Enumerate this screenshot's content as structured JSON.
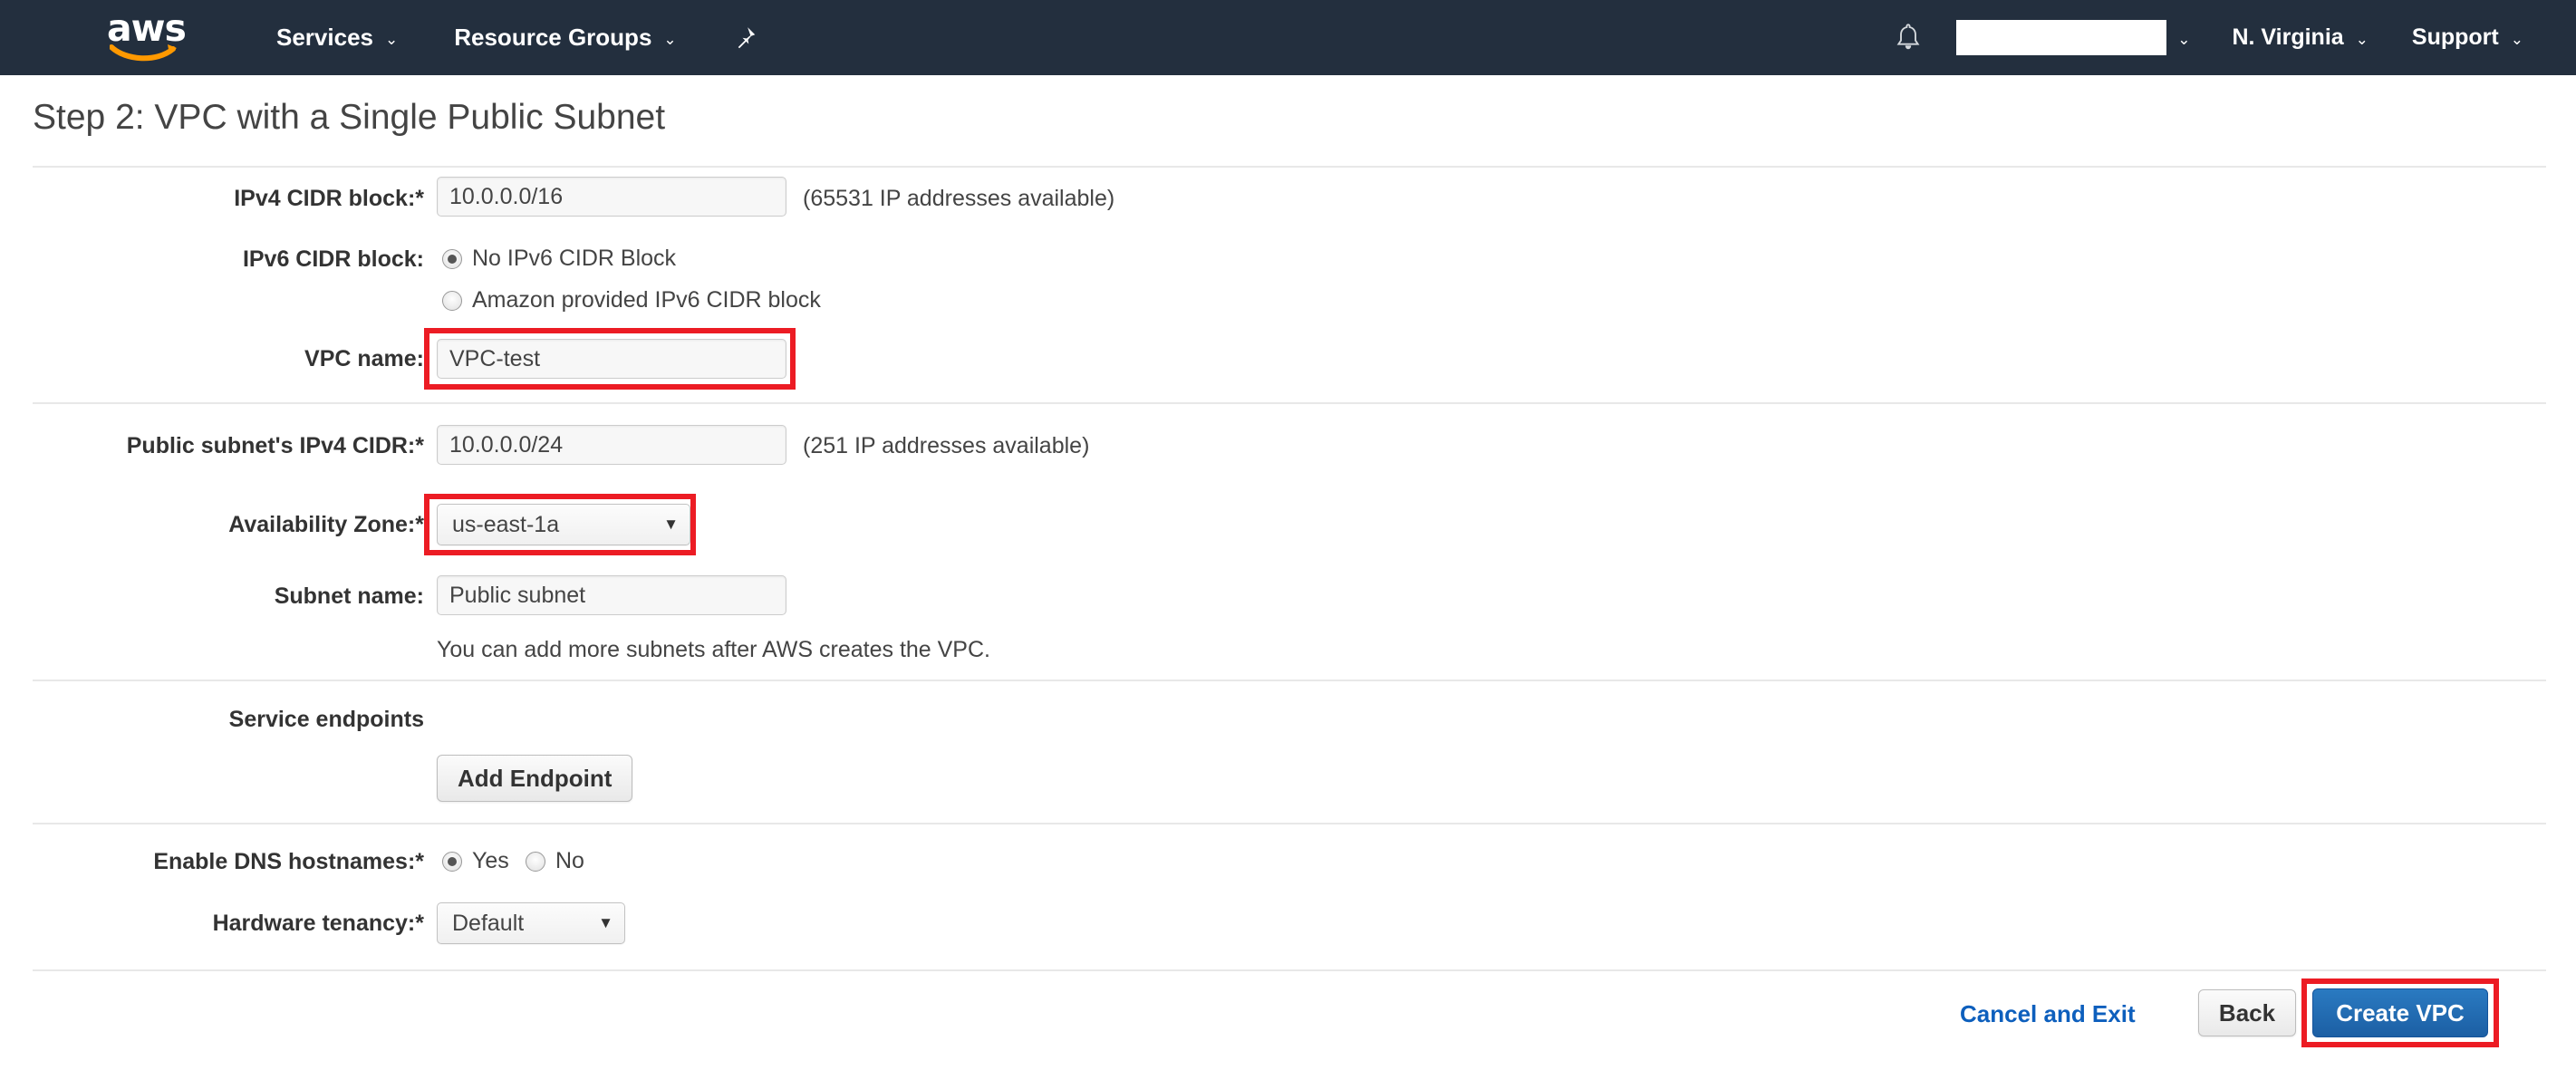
{
  "navbar": {
    "logo_text": "aws",
    "logo_name": "aws-logo",
    "services_label": "Services",
    "resource_groups_label": "Resource Groups",
    "pin_icon": "pushpin-icon",
    "bell_icon": "notifications-bell-icon",
    "account_value": "",
    "region_label": "N. Virginia",
    "support_label": "Support",
    "caret": "⌄",
    "bg_color": "#232f3e"
  },
  "page": {
    "title": "Step 2: VPC with a Single Public Subnet"
  },
  "form": {
    "ipv4_cidr": {
      "label": "IPv4 CIDR block:*",
      "value": "10.0.0.0/16",
      "hint": "(65531 IP addresses available)"
    },
    "ipv6_cidr": {
      "label": "IPv6 CIDR block:",
      "options": [
        {
          "label": "No IPv6 CIDR Block",
          "checked": true
        },
        {
          "label": "Amazon provided IPv6 CIDR block",
          "checked": false
        }
      ]
    },
    "vpc_name": {
      "label": "VPC name:",
      "value": "VPC-test",
      "highlighted": true
    },
    "public_subnet_cidr": {
      "label": "Public subnet's IPv4 CIDR:*",
      "value": "10.0.0.0/24",
      "hint": "(251 IP addresses available)"
    },
    "availability_zone": {
      "label": "Availability Zone:*",
      "value": "us-east-1a",
      "caret": "▼",
      "highlighted": true
    },
    "subnet_name": {
      "label": "Subnet name:",
      "value": "Public subnet"
    },
    "subnet_note": "You can add more subnets after AWS creates the VPC.",
    "service_endpoints": {
      "heading": "Service endpoints",
      "add_button": "Add Endpoint"
    },
    "dns_hostnames": {
      "label": "Enable DNS hostnames:*",
      "options": [
        {
          "label": "Yes",
          "checked": true
        },
        {
          "label": "No",
          "checked": false
        }
      ]
    },
    "hardware_tenancy": {
      "label": "Hardware tenancy:*",
      "value": "Default",
      "caret": "▼"
    }
  },
  "footer": {
    "cancel_label": "Cancel and Exit",
    "back_label": "Back",
    "create_label": "Create VPC",
    "create_highlighted": true
  },
  "colors": {
    "navbar_bg": "#232f3e",
    "primary_button": "#1c5fa4",
    "link": "#0d5fbd",
    "highlight": "#ec1c24",
    "divider": "#e8e8e8"
  }
}
